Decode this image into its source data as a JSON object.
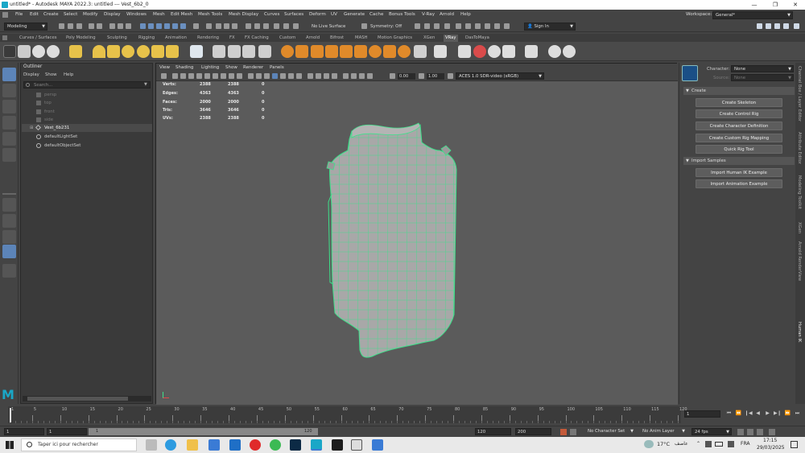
{
  "titlebar": {
    "title": "untitled* - Autodesk MAYA 2022.3: untitled   ---   Vest_6b2_0",
    "minimize": "—",
    "maximize": "❐",
    "close": "✕"
  },
  "menubar": {
    "items": [
      "File",
      "Edit",
      "Create",
      "Select",
      "Modify",
      "Display",
      "Windows",
      "Mesh",
      "Edit Mesh",
      "Mesh Tools",
      "Mesh Display",
      "Curves",
      "Surfaces",
      "Deform",
      "UV",
      "Generate",
      "Cache",
      "Bonus Tools",
      "V-Ray",
      "Arnold",
      "Help"
    ],
    "workspace_label": "Workspace:",
    "workspace_value": "General*"
  },
  "statusline": {
    "mode": "Modeling",
    "live_surface": "No Live Surface",
    "symmetry": "Symmetry: Off",
    "sign_in": "Sign In"
  },
  "shelf": {
    "tabs": [
      "Curves / Surfaces",
      "Poly Modeling",
      "Sculpting",
      "Rigging",
      "Animation",
      "Rendering",
      "FX",
      "FX Caching",
      "Custom",
      "Arnold",
      "Bifrost",
      "MASH",
      "Motion Graphics",
      "XGen",
      "VRay",
      "DasToMaya"
    ],
    "active_tab": "VRay"
  },
  "outliner": {
    "title": "Outliner",
    "menu": [
      "Display",
      "Show",
      "Help"
    ],
    "search_placeholder": "Search...",
    "items": [
      {
        "label": "persp",
        "state": "dim"
      },
      {
        "label": "top",
        "state": "dim"
      },
      {
        "label": "front",
        "state": "dim"
      },
      {
        "label": "side",
        "state": "dim"
      },
      {
        "label": "Vest_6b231",
        "state": "selected"
      },
      {
        "label": "defaultLightSet",
        "state": "normal"
      },
      {
        "label": "defaultObjectSet",
        "state": "normal"
      }
    ]
  },
  "viewport": {
    "menu": [
      "View",
      "Shading",
      "Lighting",
      "Show",
      "Renderer",
      "Panels"
    ],
    "gamma_a": "0.00",
    "gamma_b": "1.00",
    "colorspace": "ACES 1.0 SDR-video (sRGB)",
    "hud": {
      "rows": [
        {
          "label": "Verts:",
          "a": "2388",
          "b": "2388",
          "c": "0"
        },
        {
          "label": "Edges:",
          "a": "4363",
          "b": "4363",
          "c": "0"
        },
        {
          "label": "Faces:",
          "a": "2000",
          "b": "2000",
          "c": "0"
        },
        {
          "label": "Tris:",
          "a": "3646",
          "b": "3646",
          "c": "0"
        },
        {
          "label": "UVs:",
          "a": "2388",
          "b": "2388",
          "c": "0"
        }
      ]
    }
  },
  "humanik": {
    "character_label": "Character:",
    "character_value": "None",
    "source_label": "Source:",
    "source_value": "None",
    "create_section": "Create",
    "create_buttons": [
      "Create Skeleton",
      "Create Control Rig",
      "Create Character Definition",
      "Create Custom Rig Mapping",
      "Quick Rig Tool"
    ],
    "import_section": "Import Samples",
    "import_buttons": [
      "Import Human IK Example",
      "Import Animation Example"
    ]
  },
  "side_tabs": [
    "Channel Box / Layer Editor",
    "Attribute Editor",
    "Modeling Toolkit",
    "XGen",
    "Arnold RenderView",
    "Human IK"
  ],
  "timeslider": {
    "ticks": [
      "1",
      "5",
      "10",
      "15",
      "20",
      "25",
      "30",
      "35",
      "40",
      "45",
      "50",
      "55",
      "60",
      "65",
      "70",
      "75",
      "80",
      "85",
      "90",
      "95",
      "100",
      "105",
      "110",
      "115",
      "120"
    ],
    "current_frame": "1"
  },
  "rangeslider": {
    "start": "1",
    "start2": "1",
    "range_start_label": "1",
    "range_end_label": "120",
    "end": "120",
    "end2": "200",
    "character_set": "No Character Set",
    "anim_layer": "No Anim Layer",
    "fps": "24 fps"
  },
  "taskbar": {
    "search_placeholder": "Taper ici pour rechercher",
    "weather": "17°C",
    "weather_desc": "عاصف",
    "language": "FRA",
    "time": "17:15",
    "date": "29/03/2025"
  },
  "colors": {
    "wireframe": "#3de18a",
    "mesh_fill": "#a8a8a8",
    "viewport_bg": "#5b5b5b",
    "maya_blue": "#1aa7c7"
  }
}
